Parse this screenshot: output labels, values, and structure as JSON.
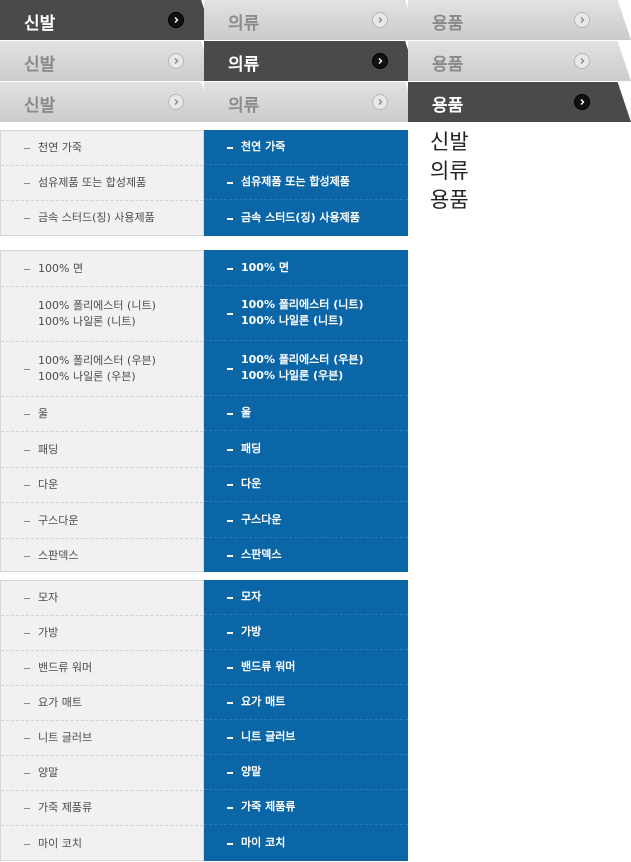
{
  "tab_rows": [
    {
      "tabs": [
        {
          "label": "신발",
          "active": true
        },
        {
          "label": "의류",
          "active": false
        },
        {
          "label": "용품",
          "active": false
        }
      ]
    },
    {
      "tabs": [
        {
          "label": "신발",
          "active": false
        },
        {
          "label": "의류",
          "active": true
        },
        {
          "label": "용품",
          "active": false
        }
      ]
    },
    {
      "tabs": [
        {
          "label": "신발",
          "active": false
        },
        {
          "label": "의류",
          "active": false
        },
        {
          "label": "용품",
          "active": true
        }
      ]
    }
  ],
  "plain_menu": [
    "신발",
    "의류",
    "용품"
  ],
  "lists": [
    {
      "items": [
        "천연 가죽",
        "섬유제품 또는 합성제품",
        "금속 스터드(징) 사용제품"
      ]
    },
    {
      "items": [
        "100% 면",
        "100%  폴리에스터 (니트)\n100% 나일론 (니트)",
        "100%  폴리에스터 (우븐)\n100% 나일론 (우븐)",
        "울",
        "패딩",
        "다운",
        "구스다운",
        "스판덱스"
      ]
    },
    {
      "items": [
        "모자",
        "가방",
        "밴드류 워머",
        "요가 매트",
        "니트 글러브",
        "양말",
        "가죽 제품류",
        "마이 코치"
      ]
    }
  ],
  "colors": {
    "active_tab": "#4a4a4a",
    "inactive_tab": "#d5d5d5",
    "blue": "#0b66a8",
    "grey": "#f1f1f1"
  },
  "icons": {
    "tab_arrow": "chevron-right-circle-icon",
    "list_bullet": "dash-icon"
  }
}
